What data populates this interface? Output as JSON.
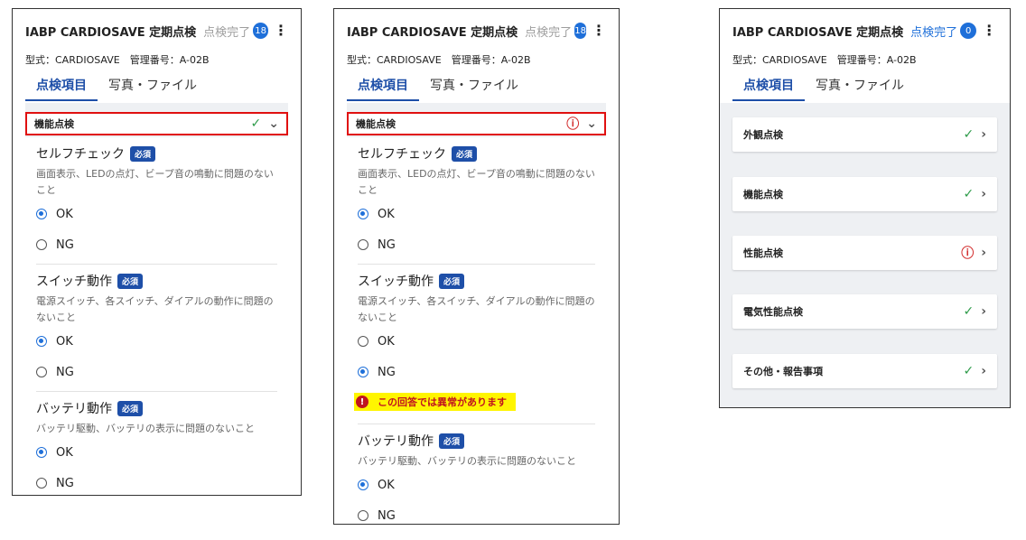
{
  "common": {
    "app_title": "IABP CARDIOSAVE 定期点検",
    "done_label": "点検完了",
    "model_text": "型式：CARDIOSAVE　管理番号：A-02B",
    "tabs": [
      "点検項目",
      "写真・ファイル"
    ],
    "required_label": "必須"
  },
  "panel1": {
    "badge": "18",
    "section": "機能点検",
    "questions": [
      {
        "title": "セルフチェック",
        "desc": "画面表示、LEDの点灯、ビープ音の鳴動に問題のないこと",
        "ok": "OK",
        "ng": "NG"
      },
      {
        "title": "スイッチ動作",
        "desc": "電源スイッチ、各スイッチ、ダイアルの動作に問題のないこと",
        "ok": "OK",
        "ng": "NG"
      },
      {
        "title": "バッテリ動作",
        "desc": "バッテリ駆動、バッテリの表示に問題のないこと",
        "ok": "OK",
        "ng": "NG"
      }
    ]
  },
  "panel2": {
    "badge": "18",
    "section": "機能点検",
    "warning": "この回答では異常があります",
    "questions": [
      {
        "title": "セルフチェック",
        "desc": "画面表示、LEDの点灯、ビープ音の鳴動に問題のないこと",
        "ok": "OK",
        "ng": "NG"
      },
      {
        "title": "スイッチ動作",
        "desc": "電源スイッチ、各スイッチ、ダイアルの動作に問題のないこと",
        "ok": "OK",
        "ng": "NG"
      },
      {
        "title": "バッテリ動作",
        "desc": "バッテリ駆動、バッテリの表示に問題のないこと",
        "ok": "OK",
        "ng": "NG"
      }
    ]
  },
  "panel3": {
    "badge": "0",
    "items": [
      {
        "label": "外観点検",
        "status": "check"
      },
      {
        "label": "機能点検",
        "status": "check"
      },
      {
        "label": "性能点検",
        "status": "alert"
      },
      {
        "label": "電気性能点検",
        "status": "check"
      },
      {
        "label": "その他・報告事項",
        "status": "check"
      }
    ]
  },
  "icons": {
    "check": "check-icon",
    "alert": "alert-circle-icon",
    "chevron": "chevron-right-icon",
    "menu": "kebab-menu-icon"
  },
  "colors": {
    "accent": "#1e6fd9",
    "tab_active": "#1e4fa8",
    "highlight_border": "#e01010",
    "warning_bg": "#fff500",
    "ok_green": "#2e9b4a",
    "alert_red": "#d32f2f"
  }
}
